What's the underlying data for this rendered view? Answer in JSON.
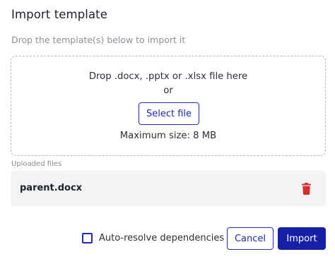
{
  "dialog": {
    "title": "Import template",
    "subtitle": "Drop the template(s) below to import it"
  },
  "dropzone": {
    "instruction": "Drop .docx, .pptx or .xlsx file here",
    "or_text": "or",
    "select_button_label": "Select file",
    "max_size_text": "Maximum size: 8 MB"
  },
  "uploaded": {
    "label": "Uploaded files",
    "files": [
      {
        "name": "parent.docx",
        "action_icon": "trash-icon"
      }
    ]
  },
  "footer": {
    "checkbox_label": "Auto-resolve dependencies",
    "checkbox_checked": false,
    "cancel_label": "Cancel",
    "import_label": "Import"
  },
  "colors": {
    "accent": "#1520a6",
    "delete_icon": "#d32f2f",
    "file_row_bg": "#f2f3f5"
  }
}
